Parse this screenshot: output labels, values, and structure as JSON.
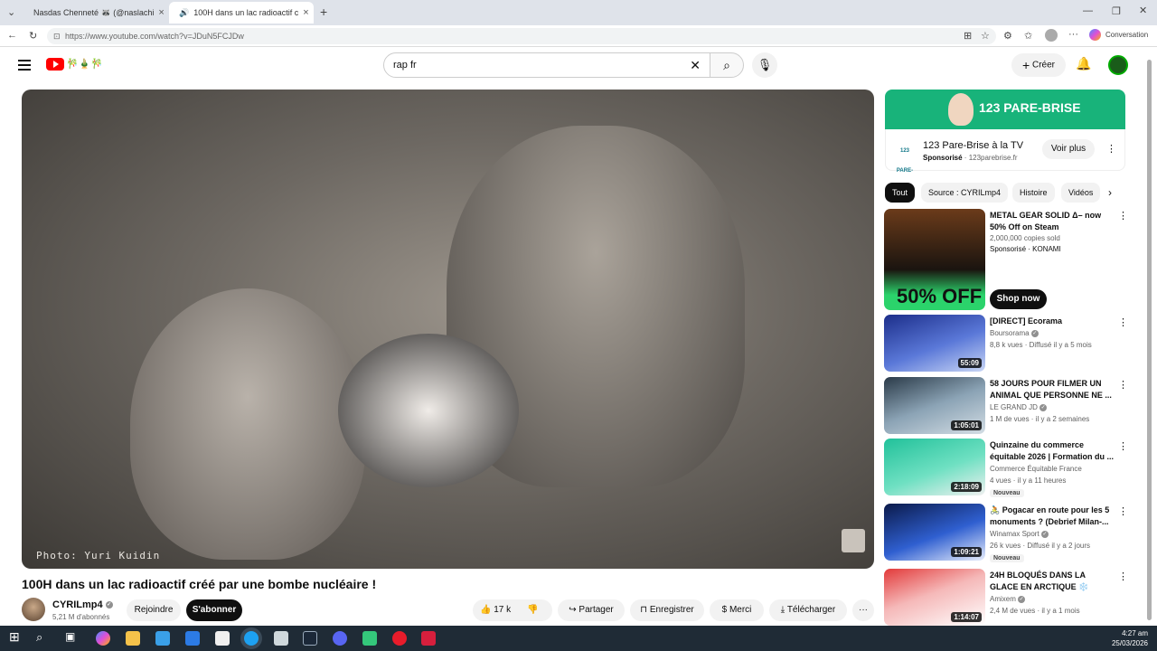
{
  "browser": {
    "tabs": [
      {
        "label": "Nasdas Chenneté 🦝 (@naslachi",
        "active": false
      },
      {
        "label": "100H dans un lac radioactif c",
        "active": true
      }
    ],
    "url": "https://www.youtube.com/watch?v=JDuN5FCJDw",
    "conversation_label": "Conversation"
  },
  "header": {
    "search_value": "rap fr",
    "create_label": "Créer"
  },
  "video": {
    "photo_credit": "Photo: Yuri Kuidin",
    "title": "100H dans un lac radioactif créé par une bombe nucléaire !",
    "channel_name": "CYRILmp4",
    "subscribers": "5,21 M d'abonnés",
    "join_label": "Rejoindre",
    "subscribe_label": "S'abonner",
    "likes": "17 k",
    "share_label": "Partager",
    "save_label": "Enregistrer",
    "thanks_label": "Merci",
    "download_label": "Télécharger"
  },
  "ad": {
    "brand": "123 PARE-BRISE",
    "logo_text": "123 PARE-BRISE",
    "title": "123 Pare-Brise à la TV",
    "sponsored": "Sponsorisé",
    "domain": "123parebrise.fr",
    "cta": "Voir plus"
  },
  "chips": [
    "Tout",
    "Source : CYRILmp4",
    "Histoire",
    "Vidéos"
  ],
  "recommendations": [
    {
      "title": "METAL GEAR SOLID Δ– now 50% Off on Steam",
      "meta1": "2,000,000 copies sold",
      "meta2": "Sponsorisé · KONAMI",
      "cta": "Shop now",
      "thumb_text": "50% OFF"
    },
    {
      "title": "[DIRECT] Ecorama",
      "channel": "Boursorama",
      "meta": "8,8 k vues · Diffusé il y a 5 mois",
      "duration": "55:09"
    },
    {
      "title": "58 JOURS POUR FILMER UN ANIMAL QUE PERSONNE NE ...",
      "channel": "LE GRAND JD",
      "meta": "1 M de vues · il y a 2 semaines",
      "duration": "1:05:01"
    },
    {
      "title": "Quinzaine du commerce équitable 2026 | Formation du ...",
      "channel": "Commerce Équitable France",
      "meta": "4 vues · il y a 11 heures",
      "badge": "Nouveau",
      "duration": "2:18:09"
    },
    {
      "title": "🚴 Pogacar en route pour les 5 monuments ? (Debrief Milan-...",
      "channel": "Winamax Sport",
      "meta": "26 k vues · Diffusé il y a 2 jours",
      "badge": "Nouveau",
      "duration": "1:09:21"
    },
    {
      "title": "24H BLOQUÉS DANS LA GLACE EN ARCTIQUE ❄️",
      "channel": "Amixem",
      "meta": "2,4 M de vues · il y a 1 mois",
      "duration": "1:14:07"
    }
  ],
  "taskbar": {
    "time": "4:27 am",
    "date": "25/03/2026"
  },
  "colors": {
    "yt_red": "#ff0000",
    "taskbar": "#1f2b36",
    "ad_green": "#18b37a"
  }
}
